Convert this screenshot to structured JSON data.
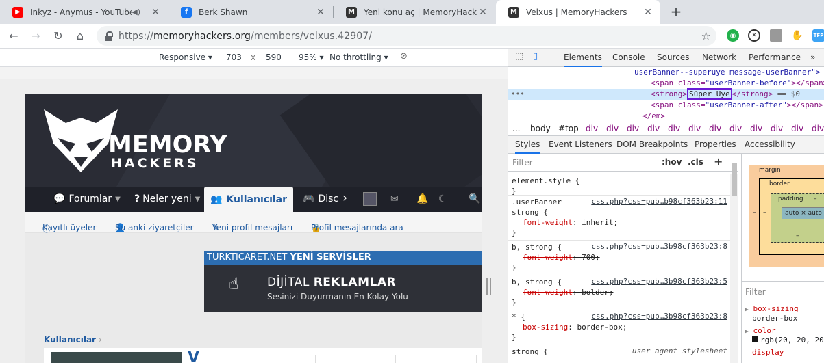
{
  "tabs": [
    {
      "title": "Inkyz - Anymus - YouTube",
      "icon": "youtube-icon",
      "audio": true
    },
    {
      "title": "Berk Shawn",
      "icon": "facebook-icon"
    },
    {
      "title": "Yeni konu aç | MemoryHackers",
      "icon": "memoryhackers-icon"
    },
    {
      "title": "Velxus | MemoryHackers",
      "icon": "memoryhackers-icon",
      "active": true
    }
  ],
  "omnibox": {
    "scheme": "https://",
    "host": "memoryhackers.org",
    "path": "/members/velxus.42907/"
  },
  "device_toolbar": {
    "mode": "Responsive",
    "width": "703",
    "times": "x",
    "height": "590",
    "zoom": "95%",
    "throttle": "No throttling"
  },
  "site": {
    "logo_line1": "MEMORY",
    "logo_line2": "HACKERS",
    "nav": [
      "Forumlar",
      "Neler yeni",
      "Kullanıcılar",
      "Disc"
    ],
    "subnav": [
      "Kayıtlı üyeler",
      "Şu anki ziyaretçiler",
      "Yeni profil mesajları",
      "Profil mesajlarında ara"
    ],
    "banner_top_plain": "TURKTICARET.NET",
    "banner_top_bold": "YENİ SERVİSLER",
    "banner_title_plain": "DİJİTAL ",
    "banner_title_bold": "REKLAMLAR",
    "banner_sub": "Sesinizi Duyurmanın En Kolay Yolu",
    "breadcrumb": "Kullanıcılar",
    "profile_initial": "V"
  },
  "devtools": {
    "tabs": [
      "Elements",
      "Console",
      "Sources",
      "Network",
      "Performance"
    ],
    "more": "»",
    "dom": {
      "line1": "userBanner--superuye message-userBanner\">",
      "line2_tag_open": "<span class=",
      "line2_val": "\"userBanner-before\"",
      "line2_close": "></span>",
      "line3_tag": "<strong>",
      "line3_text": "Süper Üye",
      "line3_close": "</strong>",
      "line3_eq": " == $0",
      "line4_tag_open": "<span class=",
      "line4_val": "\"userBanner-after\"",
      "line4_close": "></span>",
      "line5": "</em>",
      "ellipsis": "•••"
    },
    "breadcrumbs": [
      "...",
      "body",
      "#top",
      "div",
      "div",
      "div",
      "div",
      "div",
      "div",
      "div",
      "div",
      "div",
      "div",
      "div",
      "div",
      "div"
    ],
    "subtabs": [
      "Styles",
      "Event Listeners",
      "DOM Breakpoints",
      "Properties",
      "Accessibility"
    ],
    "filter_placeholder": "Filter",
    "hov": ":hov",
    "cls": ".cls",
    "plus": "+",
    "rules": [
      {
        "selector": "element.style {",
        "lines": [],
        "close": "}"
      },
      {
        "selector": ".userBanner",
        "selector2": "strong {",
        "source": "css.php?css=pub…b98cf363b23:11",
        "lines": [
          {
            "prop": "font-weight",
            "val": "inherit;",
            "struck": false
          }
        ],
        "close": "}"
      },
      {
        "selector": "b, strong {",
        "source": "css.php?css=pub…3b98cf363b23:8",
        "lines": [
          {
            "prop": "font-weight",
            "val": "700;",
            "struck": true
          }
        ],
        "close": "}"
      },
      {
        "selector": "b, strong {",
        "source": "css.php?css=pub…3b98cf363b23:5",
        "lines": [
          {
            "prop": "font-weight",
            "val": "bolder;",
            "struck": true
          }
        ],
        "close": "}"
      },
      {
        "selector": "* {",
        "source": "css.php?css=pub…3b98cf363b23:8",
        "lines": [
          {
            "prop": "box-sizing",
            "val": "border-box;",
            "struck": false
          }
        ],
        "close": "}"
      },
      {
        "selector": "strong {",
        "source": "user agent stylesheet",
        "lines": [],
        "close": ""
      }
    ],
    "boxmodel": {
      "margin": "margin",
      "border": "border",
      "padding": "padding",
      "content": "auto × auto",
      "dash": "–"
    },
    "computed_filter": "Filter",
    "computed": [
      {
        "prop": "box-sizing",
        "val": "border-box"
      },
      {
        "prop": "color",
        "val": "rgb(20, 20, 20"
      },
      {
        "prop": "display",
        "val": ""
      }
    ]
  },
  "colors": {
    "accent": "#1a73e8",
    "site_blue": "#1f5aa0",
    "highlight_box": "#6a1bd6"
  }
}
